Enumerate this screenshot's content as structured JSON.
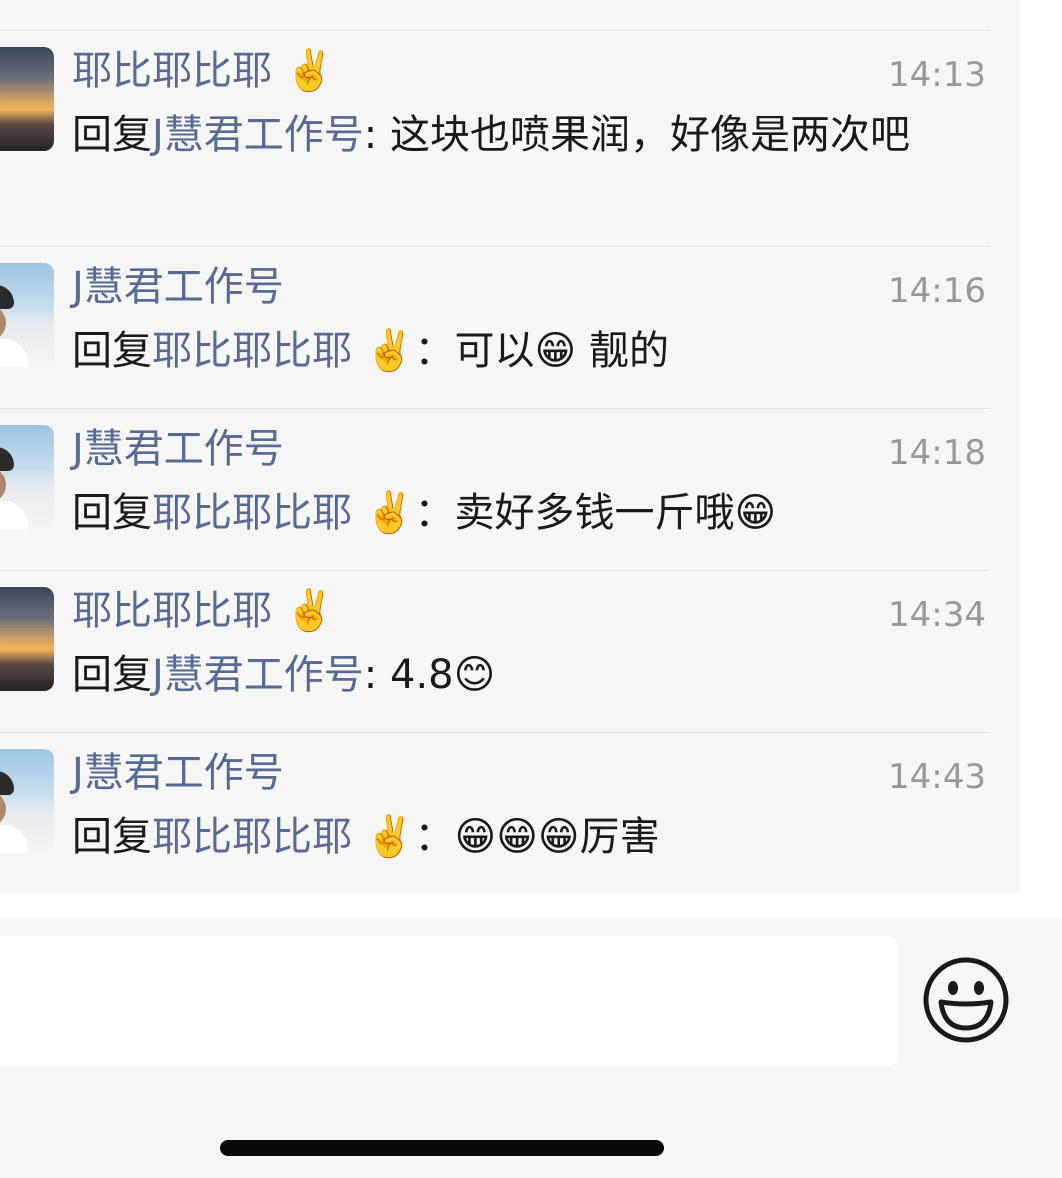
{
  "comments": [
    {
      "name": "耶比耶比耶 ✌️",
      "time": "14:13",
      "reply_prefix": "回复",
      "reply_to": "J慧君工作号",
      "colon": ": ",
      "text": "这块也喷果润，好像是两次吧",
      "avatar": "sunset-avatar"
    },
    {
      "name": "J慧君工作号",
      "time": "14:16",
      "reply_prefix": "回复",
      "reply_to": "耶比耶比耶 ✌️",
      "colon": "：",
      "text": "可以😁 靓的",
      "avatar": "person-avatar"
    },
    {
      "name": "J慧君工作号",
      "time": "14:18",
      "reply_prefix": "回复",
      "reply_to": "耶比耶比耶 ✌️",
      "colon": "：",
      "text": "卖好多钱一斤哦😁",
      "avatar": "person-avatar"
    },
    {
      "name": "耶比耶比耶 ✌️",
      "time": "14:34",
      "reply_prefix": "回复",
      "reply_to": "J慧君工作号",
      "colon": ": ",
      "text": "4.8😊",
      "avatar": "sunset-avatar"
    },
    {
      "name": "J慧君工作号",
      "time": "14:43",
      "reply_prefix": "回复",
      "reply_to": "耶比耶比耶 ✌️",
      "colon": "：",
      "text": "😁😁😁厉害",
      "avatar": "person-avatar"
    }
  ],
  "input": {
    "placeholder": "",
    "emoji_icon": "smiley-face-icon"
  },
  "colors": {
    "link": "#576b95",
    "timestamp": "#999999",
    "panel_bg": "#f6f6f6"
  }
}
